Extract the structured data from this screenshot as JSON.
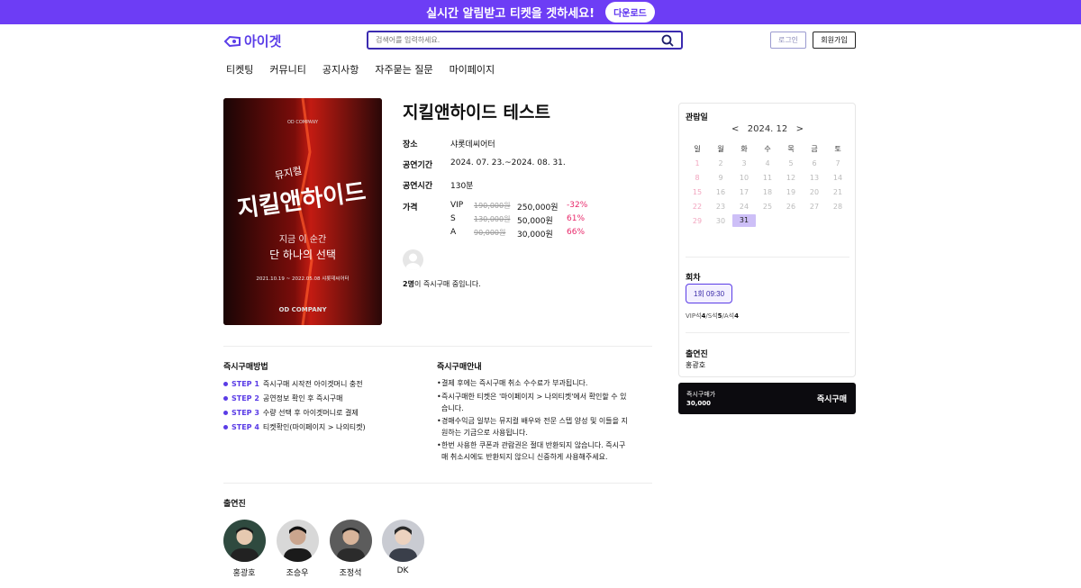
{
  "banner": {
    "text": "실시간 알림받고 티켓을 겟하세요!",
    "download": "다운로드"
  },
  "header": {
    "logo": "아이겟",
    "search_placeholder": "검색어를 입력하세요.",
    "login": "로그인",
    "join": "회원가입"
  },
  "nav": [
    "티켓팅",
    "커뮤니티",
    "공지사항",
    "자주묻는 질문",
    "마이페이지"
  ],
  "poster": {
    "line1": "뮤지컬",
    "line2": "지킬앤하이드",
    "line3": "지금 이 순간",
    "line4": "단 하나의 선택",
    "dates": "2021.10.19 ~ 2022.05.08 샤롯데씨어터",
    "company": "OD COMPANY"
  },
  "show": {
    "title": "지킬앤하이드 테스트",
    "venue_label": "장소",
    "venue": "샤롯데씨어터",
    "period_label": "공연기간",
    "period": "2024. 07. 23.~2024. 08. 31.",
    "runtime_label": "공연시간",
    "runtime": "130분",
    "price_label": "가격",
    "prices": [
      {
        "grade": "VIP",
        "orig": "190,000원",
        "now": "250,000원",
        "disc": "-32%"
      },
      {
        "grade": "S",
        "orig": "130,000원",
        "now": "50,000원",
        "disc": "61%"
      },
      {
        "grade": "A",
        "orig": "90,000원",
        "now": "30,000원",
        "disc": "66%"
      }
    ],
    "buyers_count": "2명",
    "buyers_text": "이 즉시구매 중입니다."
  },
  "how": {
    "title": "즉시구매방법",
    "steps": [
      {
        "label": "STEP 1",
        "text": "즉시구매 시작전 아이겟머니 충전"
      },
      {
        "label": "STEP 2",
        "text": "공연정보 확인 후 즉시구매"
      },
      {
        "label": "STEP 3",
        "text": "수량 선택 후 아이겟머니로 결제"
      },
      {
        "label": "STEP 4",
        "text": "티켓확인(마이페이지 > 나의티켓)"
      }
    ]
  },
  "guide": {
    "title": "즉시구매안내",
    "items": [
      "결제 후에는 즉시구매 취소 수수료가 부과됩니다.",
      "즉시구매한 티켓은 '마이페이지 > 나의티켓'에서 확인할 수 있습니다.",
      "경매수익금 일부는 뮤지컬 배우와 전문 스텝 양성 및 이들을 지원하는 기금으로 사용됩니다.",
      "한번 사용한 쿠폰과 관람권은 절대 반환되지 않습니다. 즉시구매 취소시에도 반환되지 않으니 신중하게 사용해주세요."
    ]
  },
  "cast": {
    "title": "출연진",
    "members": [
      "홍광호",
      "조승우",
      "조정석",
      "DK"
    ]
  },
  "calendar": {
    "title": "관람일",
    "month": "2024. 12",
    "prev": "<",
    "next": ">",
    "weekdays": [
      "일",
      "월",
      "화",
      "수",
      "목",
      "금",
      "토"
    ],
    "weeks": [
      [
        "1",
        "2",
        "3",
        "4",
        "5",
        "6",
        "7"
      ],
      [
        "8",
        "9",
        "10",
        "11",
        "12",
        "13",
        "14"
      ],
      [
        "15",
        "16",
        "17",
        "18",
        "19",
        "20",
        "21"
      ],
      [
        "22",
        "23",
        "24",
        "25",
        "26",
        "27",
        "28"
      ],
      [
        "29",
        "30",
        "31",
        "",
        "",
        "",
        ""
      ]
    ],
    "selected": "31"
  },
  "session": {
    "title": "회차",
    "button": "1회 09:30",
    "vip_label": "VIP석",
    "vip_count": "4",
    "s_label": "/S석",
    "s_count": "5",
    "a_label": "/A석",
    "a_count": "4"
  },
  "panel_cast": {
    "title": "출연진",
    "names": "홍광호"
  },
  "buy": {
    "label": "즉시구매가",
    "price": "30,000",
    "button": "즉시구매"
  },
  "colors": {
    "accent": "#6d3df5",
    "discount": "#e8286a",
    "dark": "#0c0b0f"
  }
}
